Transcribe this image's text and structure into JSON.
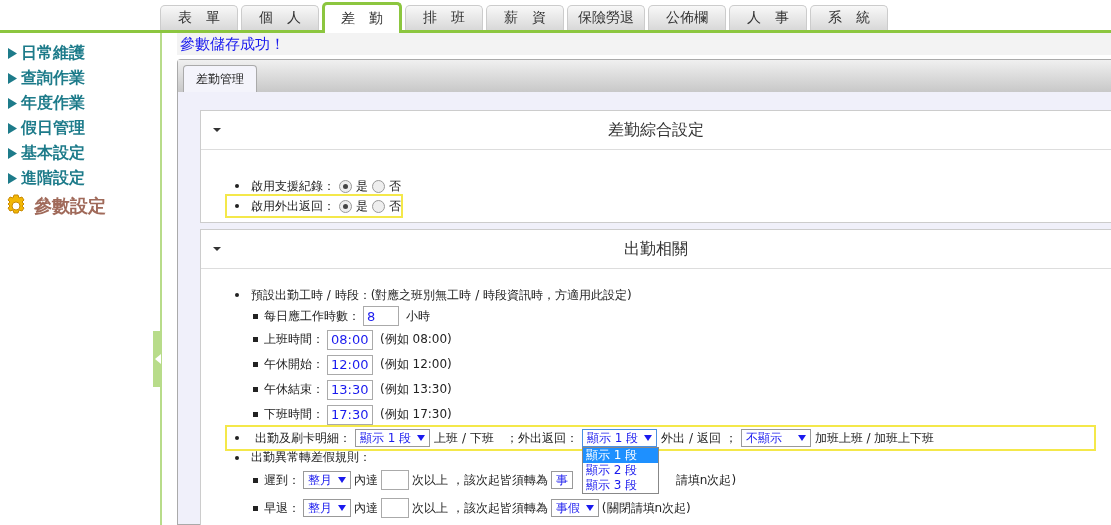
{
  "top_tabs": [
    {
      "label": "表　單",
      "selected": false
    },
    {
      "label": "個　人",
      "selected": false
    },
    {
      "label": "差　勤",
      "selected": true
    },
    {
      "label": "排　班",
      "selected": false
    },
    {
      "label": "薪　資",
      "selected": false
    },
    {
      "label": "保險勞退",
      "selected": false
    },
    {
      "label": "公佈欄",
      "selected": false
    },
    {
      "label": "人　事",
      "selected": false
    },
    {
      "label": "系　統",
      "selected": false
    }
  ],
  "sidebar": {
    "items": [
      {
        "label": "日常維護",
        "selected": false
      },
      {
        "label": "查詢作業",
        "selected": false
      },
      {
        "label": "年度作業",
        "selected": false
      },
      {
        "label": "假日管理",
        "selected": false
      },
      {
        "label": "基本設定",
        "selected": false
      },
      {
        "label": "進階設定",
        "selected": false
      },
      {
        "label": "參數設定",
        "selected": true
      }
    ]
  },
  "message": "參數儲存成功！",
  "panel_tabs": [
    {
      "label": "差勤管理",
      "selected": true
    }
  ],
  "sections": [
    {
      "title": "差勤綜合設定",
      "expanded": true,
      "items": [
        {
          "kind": "radio",
          "label": "啟用支援紀錄：",
          "highlighted": false,
          "options": [
            {
              "label": "是",
              "selected": true
            },
            {
              "label": "否",
              "selected": false
            }
          ]
        },
        {
          "kind": "radio",
          "label": "啟用外出返回：",
          "highlighted": true,
          "options": [
            {
              "label": "是",
              "selected": true
            },
            {
              "label": "否",
              "selected": false
            }
          ]
        }
      ]
    },
    {
      "title": "出勤相關",
      "expanded": true,
      "items": [
        {
          "kind": "group",
          "label": "預設出勤工時 / 時段：(對應之班別無工時 / 時段資訊時，方適用此設定)",
          "children": [
            {
              "label": "每日應工作時數：",
              "value": "8",
              "note": "小時"
            },
            {
              "label": "上班時間：",
              "value": "08:00",
              "note": "(例如 08:00)"
            },
            {
              "label": "午休開始：",
              "value": "12:00",
              "note": "(例如 12:00)"
            },
            {
              "label": "午休結束：",
              "value": "13:30",
              "note": "(例如 13:30)"
            },
            {
              "label": "下班時間：",
              "value": "17:30",
              "note": "(例如 17:30)"
            }
          ]
        },
        {
          "kind": "inline",
          "highlighted": true,
          "parts": [
            {
              "kind": "text",
              "text": "出勤及刷卡明細："
            },
            {
              "kind": "select",
              "value": "顯示 1 段",
              "open": false
            },
            {
              "kind": "text",
              "text": "上班 / 下班　；外出返回："
            },
            {
              "kind": "select",
              "value": "顯示 1 段",
              "open": true,
              "options": [
                {
                  "label": "顯示 1 段",
                  "selected": true
                },
                {
                  "label": "顯示 2 段",
                  "selected": false
                },
                {
                  "label": "顯示 3 段",
                  "selected": false
                }
              ]
            },
            {
              "kind": "text",
              "text": "外出 / 返回 ；"
            },
            {
              "kind": "select",
              "value": "不顯示",
              "open": false,
              "wide": true
            },
            {
              "kind": "text",
              "text": "加班上班 / 加班上下班"
            }
          ]
        },
        {
          "kind": "rules",
          "label": "出勤異常轉差假規則：",
          "children": [
            {
              "parts": [
                {
                  "kind": "text",
                  "text": "遲到："
                },
                {
                  "kind": "select",
                  "value": "整月",
                  "open": false
                },
                {
                  "kind": "text",
                  "text": "內達"
                },
                {
                  "kind": "input"
                },
                {
                  "kind": "text",
                  "text": "次以上 ，該次起皆須轉為"
                },
                {
                  "kind": "select",
                  "value": "事",
                  "open": false,
                  "covered": true
                },
                {
                  "kind": "text",
                  "text": "請填n次起)",
                  "covered": true
                }
              ]
            },
            {
              "parts": [
                {
                  "kind": "text",
                  "text": "早退："
                },
                {
                  "kind": "select",
                  "value": "整月",
                  "open": false
                },
                {
                  "kind": "text",
                  "text": "內達"
                },
                {
                  "kind": "input"
                },
                {
                  "kind": "text",
                  "text": "次以上 ，該次起皆須轉為"
                },
                {
                  "kind": "select",
                  "value": "事假",
                  "open": false
                },
                {
                  "kind": "text",
                  "text": "(關閉請填n次起)"
                }
              ]
            }
          ]
        }
      ]
    }
  ]
}
